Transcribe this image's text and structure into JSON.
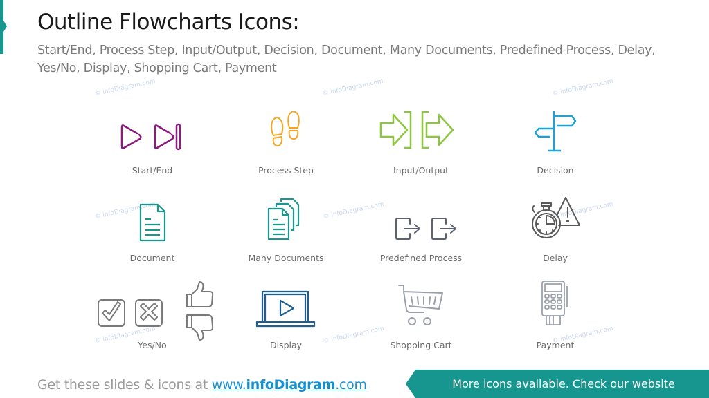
{
  "header": {
    "title": "Outline Flowcharts Icons:",
    "subtitle": "Start/End, Process Step, Input/Output, Decision, Document, Many Documents, Predefined Process, Delay, Yes/No, Display, Shopping Cart, Payment"
  },
  "watermark_text": "© infoDiagram.com",
  "icons": [
    {
      "label": "Start/End",
      "icon": "play-end-icon",
      "color": "#8b1a7f"
    },
    {
      "label": "Process Step",
      "icon": "footprints-icon",
      "color": "#f6a623"
    },
    {
      "label": "Input/Output",
      "icon": "input-output-arrows-icon",
      "color": "#8cc63f"
    },
    {
      "label": "Decision",
      "icon": "signpost-icon",
      "color": "#1ba1dc"
    },
    {
      "label": "Document",
      "icon": "document-icon",
      "color": "#1e968e"
    },
    {
      "label": "Many Documents",
      "icon": "many-documents-icon",
      "color": "#1e968e"
    },
    {
      "label": "Predefined Process",
      "icon": "predefined-process-icon",
      "color": "#5b6373"
    },
    {
      "label": "Delay",
      "icon": "stopwatch-warning-icon",
      "color": "#5a5a5a"
    },
    {
      "label": "Yes/No",
      "icon": "yes-no-icon",
      "color": "#7a7a7a"
    },
    {
      "label": "Display",
      "icon": "laptop-play-icon",
      "color": "#1f5e8e"
    },
    {
      "label": "Shopping Cart",
      "icon": "shopping-cart-icon",
      "color": "#9aa0ab"
    },
    {
      "label": "Payment",
      "icon": "payment-terminal-icon",
      "color": "#9aa0ab"
    }
  ],
  "footer": {
    "prefix": "Get these slides & icons at ",
    "link_www": "www.",
    "link_brand": "infoDiagram",
    "link_tld": ".com",
    "cta": "More icons available. Check our website"
  },
  "colors": {
    "accent": "#17968f",
    "link": "#1592d2"
  }
}
